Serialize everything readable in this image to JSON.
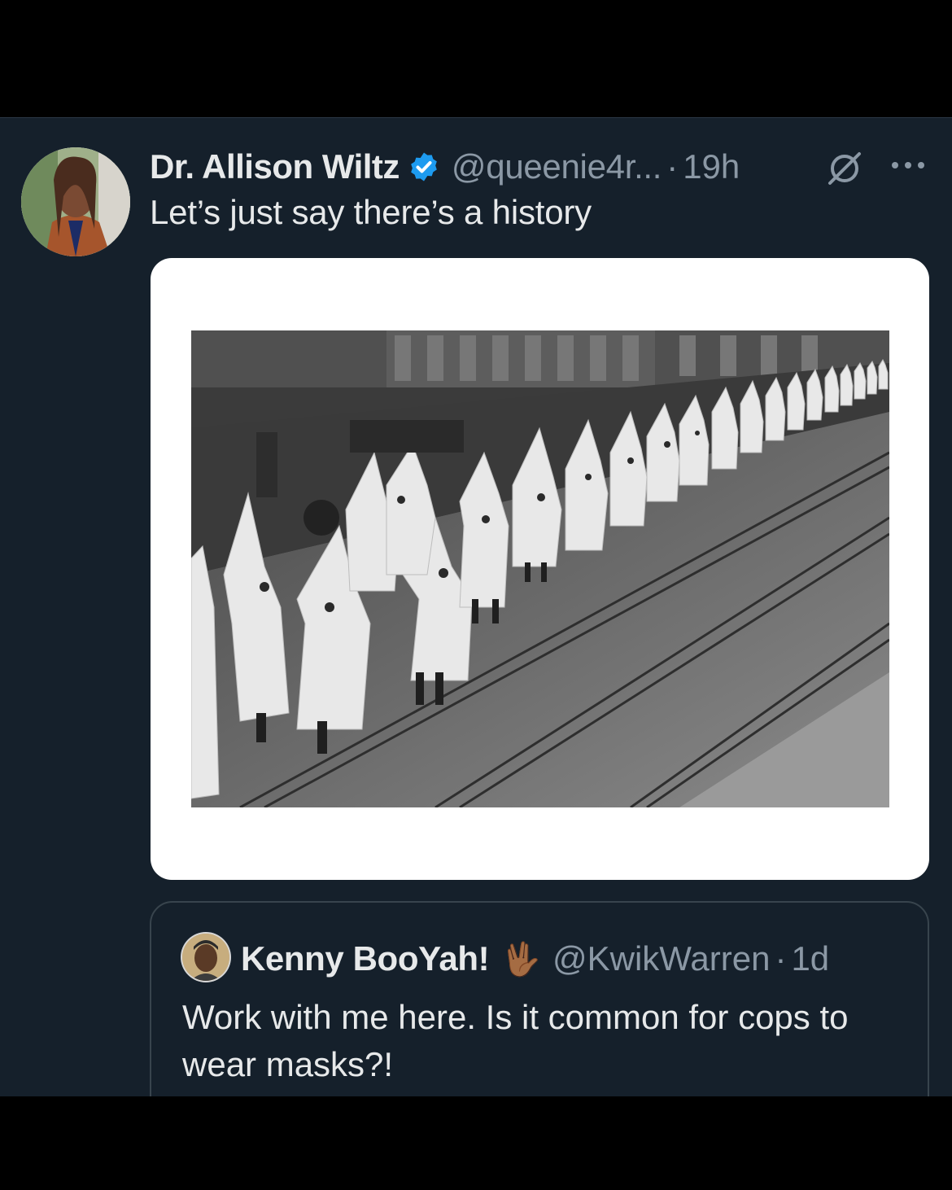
{
  "tweet": {
    "author_name": "Dr. Allison Wiltz",
    "author_handle": "@queenie4r...",
    "separator": "·",
    "time": "19h",
    "text": "Let’s just say there’s a history",
    "verified_color": "#1d9bf0",
    "media_description_icon": "historical-photo"
  },
  "quoted_tweet": {
    "author_name": "Kenny BooYah!",
    "author_emoji": "🖖🏾",
    "author_handle": "@KwikWarren",
    "separator": "·",
    "time": "1d",
    "text": "Work with me here. Is it common for cops to wear masks?!"
  },
  "colors": {
    "background": "#15202b",
    "text_primary": "#e7e9ea",
    "text_secondary": "#8b98a5",
    "border": "#38444d",
    "verified": "#1d9bf0"
  }
}
